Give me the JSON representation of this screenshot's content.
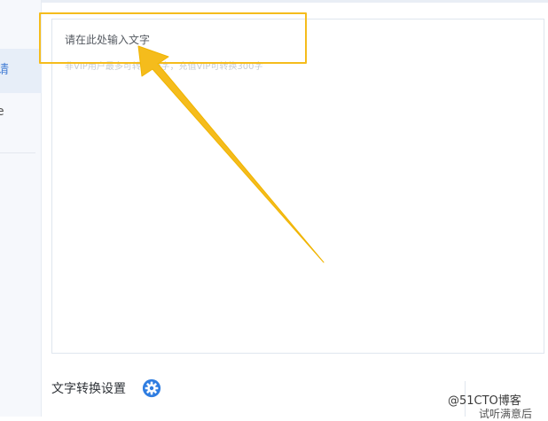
{
  "sidebar": {
    "glyph_active": "请",
    "glyph_second": "e"
  },
  "editor": {
    "placeholder": "请在此处输入文字",
    "hint": "非VIP用户最多可转换50字，充值VIP可转换300字"
  },
  "settings": {
    "label": "文字转换设置",
    "icon": "gear-icon"
  },
  "footer": {
    "watermark": "@51CTO博客",
    "partial_text": "试听满意后"
  },
  "colors": {
    "highlight": "#f5bc1c",
    "accent": "#2f7de1"
  }
}
